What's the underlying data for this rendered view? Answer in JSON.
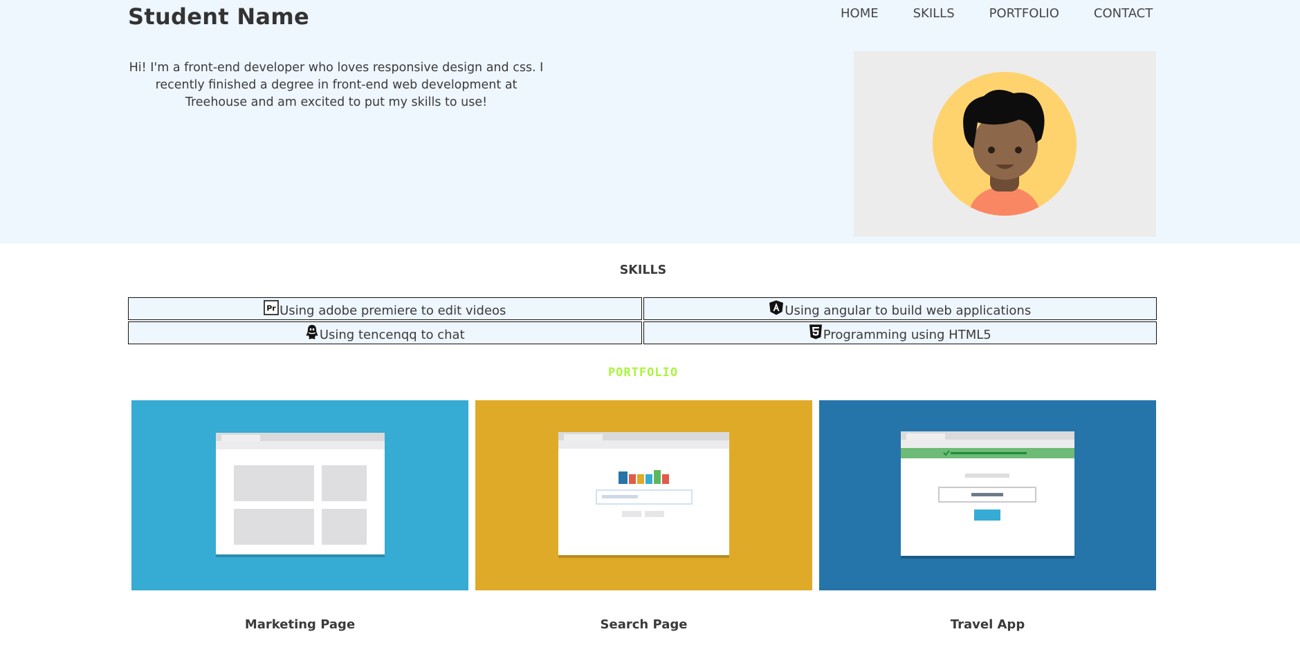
{
  "header": {
    "brand": "Student Name",
    "nav": [
      "HOME",
      "SKILLS",
      "PORTFOLIO",
      "CONTACT"
    ]
  },
  "intro": {
    "text": "Hi! I'm a front-end developer who loves responsive design and css. I recently finished a degree in front-end web development at Treehouse and am excited to put my skills to use!"
  },
  "avatar": {
    "icon": "avatar-icon"
  },
  "skills": {
    "title": "SKILLS",
    "items": [
      {
        "icon": "adobe-premiere-icon",
        "label": "Using adobe premiere to edit videos"
      },
      {
        "icon": "angular-icon",
        "label": "Using angular to build web applications"
      },
      {
        "icon": "tencentqq-icon",
        "label": "Using tencenqq to chat"
      },
      {
        "icon": "html5-icon",
        "label": "Programming using HTML5"
      }
    ]
  },
  "portfolio": {
    "title": "PORTFOLIO",
    "projects": [
      {
        "title": "Marketing Page",
        "color": "#36abd3"
      },
      {
        "title": "Search Page",
        "color": "#e0aa29"
      },
      {
        "title": "Travel App",
        "color": "#2574aa"
      }
    ]
  },
  "colors": {
    "hero_bg": "#eef6fe",
    "portfolio_title": "#aaf53a"
  }
}
